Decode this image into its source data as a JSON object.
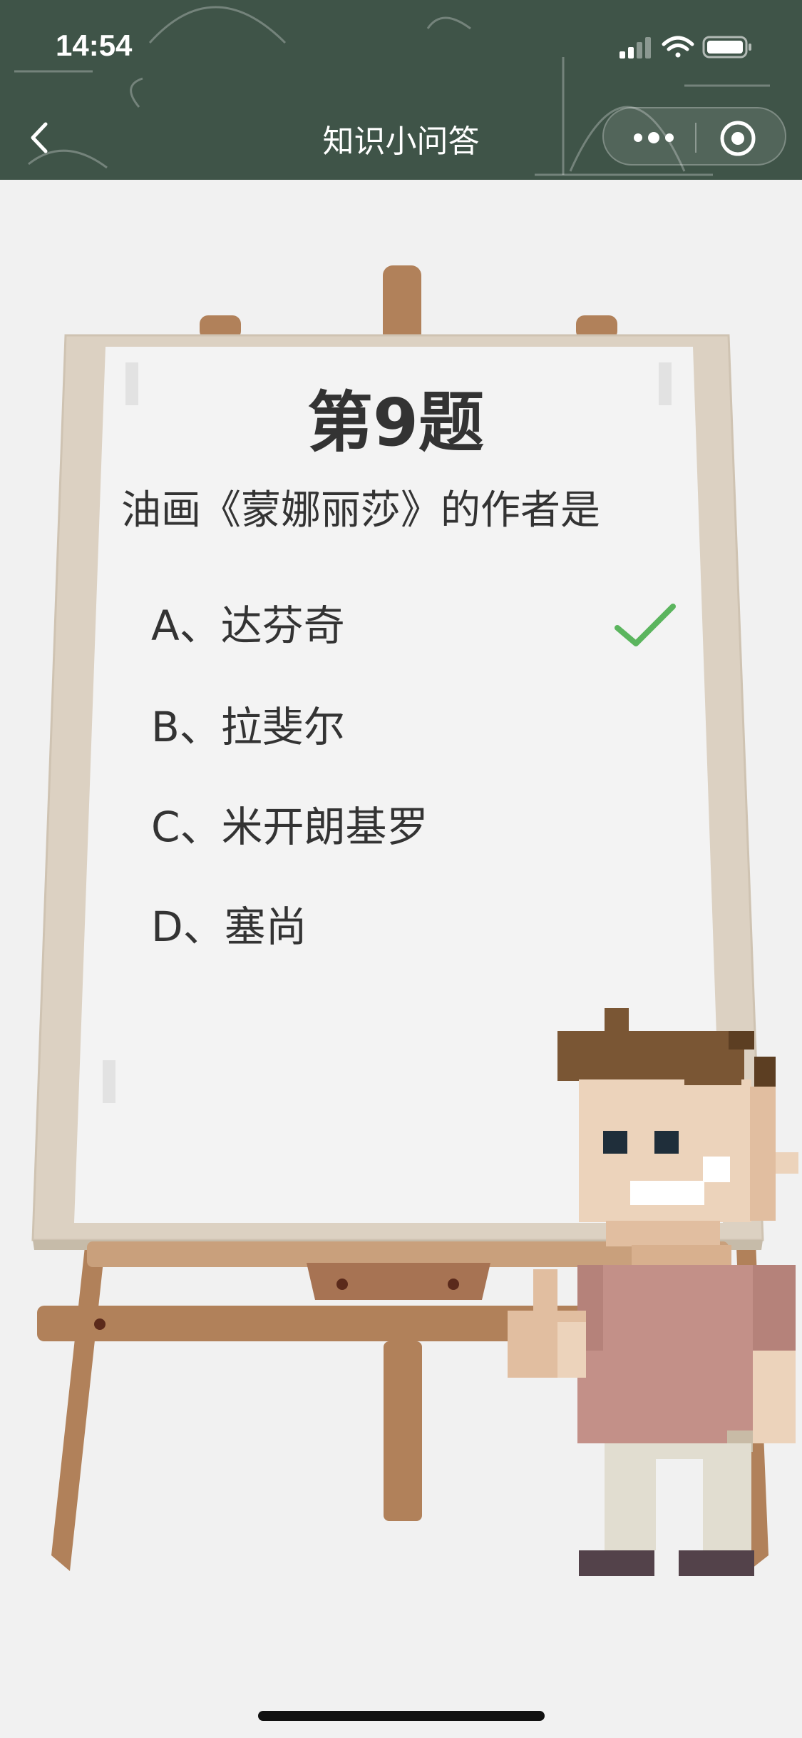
{
  "status_bar": {
    "time": "14:54"
  },
  "nav": {
    "title": "知识小问答"
  },
  "quiz": {
    "title": "第9题",
    "question": "油画《蒙娜丽莎》的作者是",
    "options": [
      {
        "label": "A、达芬奇",
        "correct": true
      },
      {
        "label": "B、拉斐尔",
        "correct": false
      },
      {
        "label": "C、米开朗基罗",
        "correct": false
      },
      {
        "label": "D、塞尚",
        "correct": false
      }
    ]
  },
  "colors": {
    "header_bg": "#3f5448",
    "check": "#5bb55e",
    "wood": "#b1815a",
    "board": "#f3f3f3"
  },
  "icons": [
    "back-icon",
    "more-icon",
    "record-icon",
    "check-icon",
    "signal-icon",
    "wifi-icon",
    "battery-icon"
  ]
}
